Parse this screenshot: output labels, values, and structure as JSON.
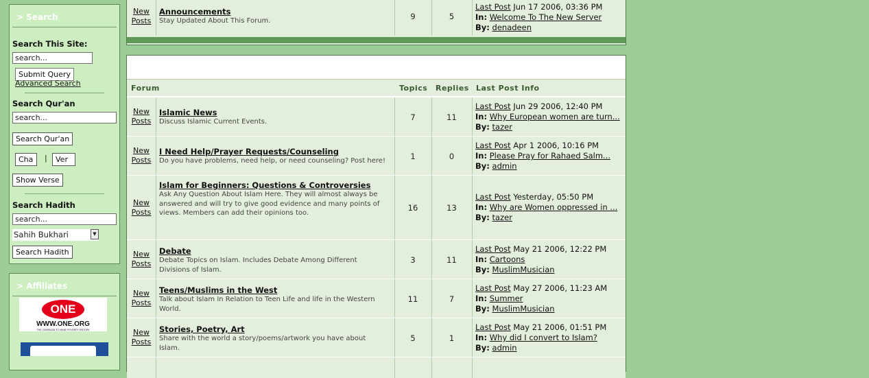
{
  "sidebar": {
    "search": {
      "title": "> Search",
      "site_label": "Search This Site:",
      "site_input": "search...",
      "submit_label": "Submit Query",
      "advanced_link": "Advanced Search",
      "quran_label": "Search Qur'an",
      "quran_input": "search...",
      "quran_button": "Search Qur'an",
      "cha_input": "Cha",
      "separator": "|",
      "ver_input": "Ver",
      "show_verse_button": "Show Verse",
      "hadith_label": "Search Hadith",
      "hadith_input": "search...",
      "hadith_select": "Sahih Bukhari",
      "hadith_button": "Search Hadith"
    },
    "affiliates": {
      "title": "> Affiliates",
      "one_logo_text": "ONE",
      "one_logo_url": "WWW.ONE.ORG",
      "one_logo_tagline": "THE CAMPAIGN TO MAKE POVERTY HISTORY"
    }
  },
  "forum": {
    "colors": {
      "row_bg": "#e3efdc",
      "page_bg": "#9ccc97",
      "border": "#4f7d47",
      "header_text": "#3a5a33"
    },
    "top_row": {
      "new_label": "New",
      "posts_label": "Posts",
      "title": "Announcements",
      "description": "Stay Updated About This Forum.",
      "topics": "9",
      "replies": "5",
      "last_post_label": "Last Post",
      "last_post_date": "Jun 17 2006, 03:36 PM",
      "in_label": "In:",
      "in_topic": "Welcome To The New Server",
      "by_label": "By:",
      "by_user": "denadeen"
    },
    "headers": {
      "forum": "Forum",
      "topics": "Topics",
      "replies": "Replies",
      "last_post": "Last Post Info"
    },
    "rows": [
      {
        "new_label": "New",
        "posts_label": "Posts",
        "title": "Islamic News",
        "description": "Discuss Islamic Current Events.",
        "topics": "7",
        "replies": "11",
        "last_post_label": "Last Post",
        "last_post_date": "Jun 29 2006, 12:40 PM",
        "in_label": "In:",
        "in_topic": "Why European women are turn...",
        "by_label": "By:",
        "by_user": "tazer"
      },
      {
        "new_label": "New",
        "posts_label": "Posts",
        "title": "I Need Help/Prayer Requests/Counseling",
        "description": "Do you have problems, need help, or need counseling? Post here!",
        "topics": "1",
        "replies": "0",
        "last_post_label": "Last Post",
        "last_post_date": "Apr 1 2006, 10:16 PM",
        "in_label": "In:",
        "in_topic": "Please Pray for Rahaed Salm...",
        "by_label": "By:",
        "by_user": "admin"
      },
      {
        "new_label": "New",
        "posts_label": "Posts",
        "title": "Islam for Beginners: Questions & Controversies",
        "description": "Ask Any Question About Islam Here. They will almost always be answered and will try to give good evidence and many points of views. Members can add their opinions too.",
        "topics": "16",
        "replies": "13",
        "last_post_label": "Last Post",
        "last_post_date": "Yesterday, 05:50 PM",
        "in_label": "In:",
        "in_topic": "Why are Women oppressed in ...",
        "by_label": "By:",
        "by_user": "tazer"
      },
      {
        "new_label": "New",
        "posts_label": "Posts",
        "title": "Debate",
        "description": "Debate Topics on Islam. Includes Debate Among Different Divisions of Islam.",
        "topics": "3",
        "replies": "11",
        "last_post_label": "Last Post",
        "last_post_date": "May 21 2006, 12:22 PM",
        "in_label": "In:",
        "in_topic": "Cartoons",
        "by_label": "By:",
        "by_user": "MuslimMusician"
      },
      {
        "new_label": "New",
        "posts_label": "Posts",
        "title": "Teens/Muslims in the West",
        "description": "Talk about Islam In Relation to Teen Life and life in the Western World.",
        "topics": "11",
        "replies": "7",
        "last_post_label": "Last Post",
        "last_post_date": "May 27 2006, 11:23 AM",
        "in_label": "In:",
        "in_topic": "Summer",
        "by_label": "By:",
        "by_user": "MuslimMusician"
      },
      {
        "new_label": "New",
        "posts_label": "Posts",
        "title": "Stories, Poetry, Art",
        "description": "Share with the world a story/poems/artwork you have about Islam.",
        "topics": "5",
        "replies": "1",
        "last_post_label": "Last Post",
        "last_post_date": "May 21 2006, 01:51 PM",
        "in_label": "In:",
        "in_topic": "Why did I convert to Islam?",
        "by_label": "By:",
        "by_user": "admin"
      }
    ]
  }
}
